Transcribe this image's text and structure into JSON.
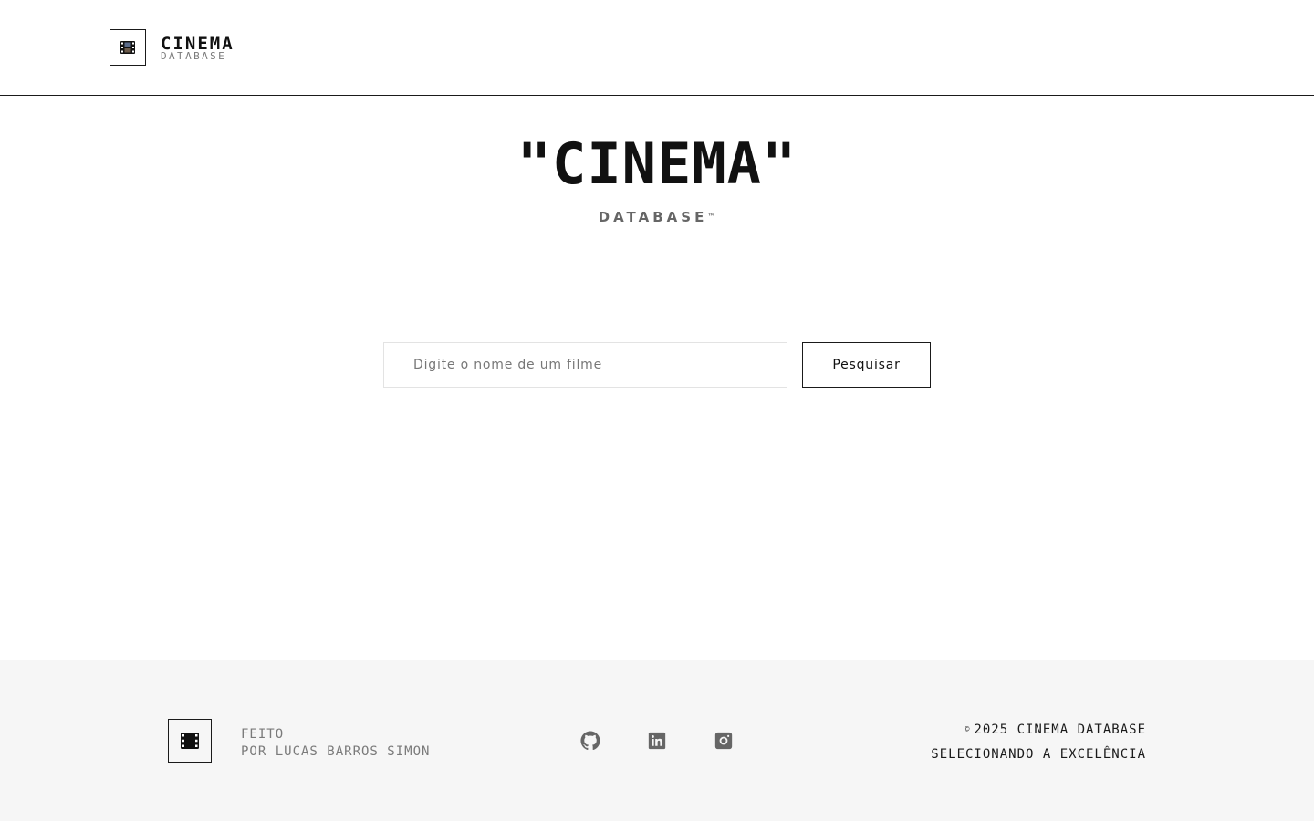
{
  "header": {
    "brand_title": "CINEMA",
    "brand_subtitle": "DATABASE",
    "logo_icon": "film-icon"
  },
  "hero": {
    "title": "\"CINEMA\"",
    "subtitle": "DATABASE",
    "trademark": "™"
  },
  "search": {
    "placeholder": "Digite o nome de um filme",
    "value": "",
    "button_label": "Pesquisar"
  },
  "footer": {
    "logo_icon": "film-icon",
    "credit_line1": "FEITO",
    "credit_line2": "POR LUCAS BARROS SIMON",
    "social": [
      {
        "name": "github-icon"
      },
      {
        "name": "linkedin-icon"
      },
      {
        "name": "instagram-icon"
      }
    ],
    "copyright_symbol": "©",
    "copyright": "2025 CINEMA DATABASE",
    "tagline": "SELECIONANDO A EXCELÊNCIA"
  },
  "colors": {
    "ink": "#111111",
    "muted": "#7a7a7a",
    "footer_bg": "#f6f6f6",
    "border": "#1a1a1a"
  }
}
